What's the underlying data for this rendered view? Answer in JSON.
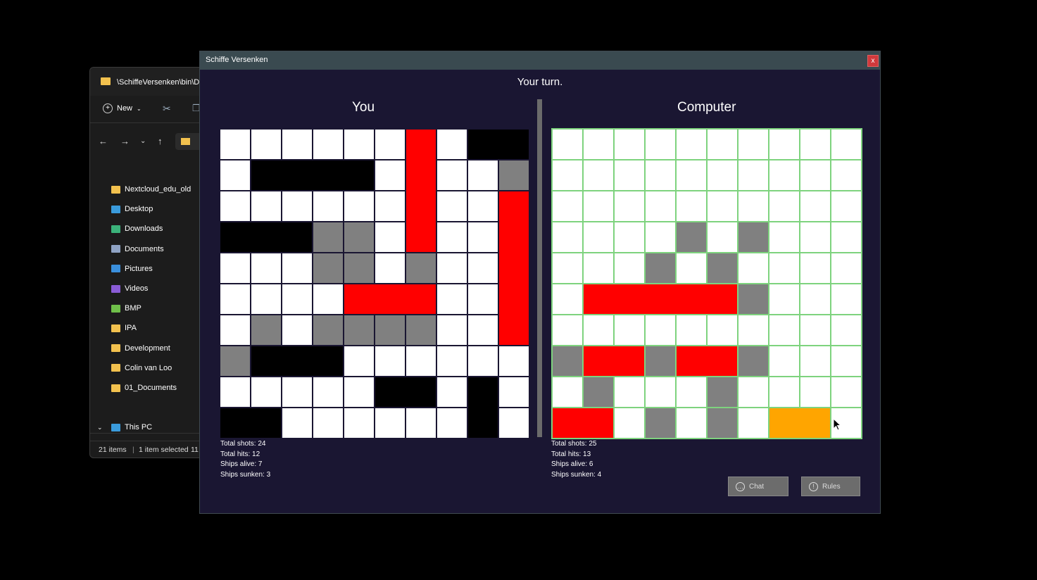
{
  "explorer": {
    "title": "\\SchiffeVersenken\\bin\\D",
    "new_label": "New",
    "sidebar": [
      {
        "label": "Nextcloud_edu_old",
        "icon": "folder-icon",
        "color": "#f2c14e"
      },
      {
        "label": "Desktop",
        "icon": "desktop-icon",
        "color": "#3a9bdc"
      },
      {
        "label": "Downloads",
        "icon": "download-icon",
        "color": "#3bb27a"
      },
      {
        "label": "Documents",
        "icon": "document-icon",
        "color": "#8fa3c4"
      },
      {
        "label": "Pictures",
        "icon": "pictures-icon",
        "color": "#3a8fdc"
      },
      {
        "label": "Videos",
        "icon": "videos-icon",
        "color": "#8a5cd6"
      },
      {
        "label": "BMP",
        "icon": "folder-icon",
        "color": "#6fbf4a"
      },
      {
        "label": "IPA",
        "icon": "folder-icon",
        "color": "#f2c14e"
      },
      {
        "label": "Development",
        "icon": "folder-icon",
        "color": "#f2c14e"
      },
      {
        "label": "Colin van Loo",
        "icon": "folder-icon",
        "color": "#f2c14e"
      },
      {
        "label": "01_Documents",
        "icon": "folder-icon",
        "color": "#f2c14e"
      }
    ],
    "this_pc": "This PC",
    "status_items": "21 items",
    "status_selected": "1 item selected",
    "status_size": "11"
  },
  "game": {
    "window_title": "Schiffe Versenken",
    "close_label": "x",
    "status": "Your turn.",
    "player": {
      "name": "You",
      "stats": {
        "shots": "Total shots: 24",
        "hits": "Total hits: 12",
        "alive": "Ships alive: 7",
        "sunken": "Ships sunken: 3"
      },
      "grid": [
        "WWWWWWRWBB",
        "WBBBBWRWWG",
        "WWWWWWRWWR",
        "BBBGGWRWWR",
        "WWWGGWGWWR",
        "WWWWRRRWWR",
        "WGWGGGGWWR",
        "GBBBWWWWWW",
        "WWWWWBBWBW",
        "BBWWWWWWBW"
      ]
    },
    "computer": {
      "name": "Computer",
      "stats": {
        "shots": "Total shots: 25",
        "hits": "Total hits: 13",
        "alive": "Ships alive: 6",
        "sunken": "Ships sunken: 4"
      },
      "grid": [
        "WWWWWWWWWW",
        "WWWWWWWWWW",
        "WWWWWWWWWW",
        "WWWWGWGWWW",
        "WWWGWGWWWW",
        "WRRRRRGWWW",
        "WWWWWWWWWW",
        "GRRGRRGWWW",
        "WGWWWGWWWW",
        "RRWGWGWOOW"
      ]
    },
    "colors": {
      "W": "#ffffff",
      "B": "#000000",
      "G": "#808080",
      "R": "#ff0000",
      "O": "#ffa500",
      "grid": "#1a1632",
      "highlight": "#7ed37e"
    },
    "buttons": {
      "chat": "Chat",
      "rules": "Rules"
    }
  }
}
